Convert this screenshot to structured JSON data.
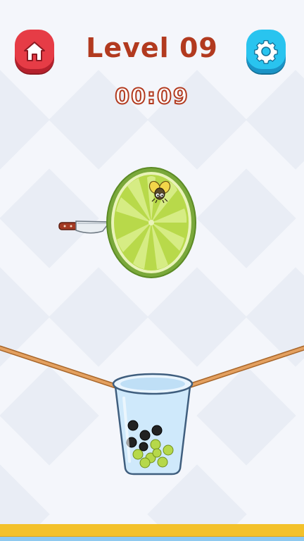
{
  "header": {
    "level_title": "Level 09",
    "timer": "00:09"
  },
  "buttons": {
    "home_icon": "home-icon",
    "settings_icon": "gear-icon"
  },
  "objects": {
    "lime_slice": "lime-slice",
    "knife": "knife",
    "fly": "fly",
    "cup": "cup",
    "black_balls": 5,
    "green_balls": 7
  },
  "colors": {
    "home_button": "#e63c46",
    "settings_button": "#29c4ef",
    "title": "#b23a1f",
    "lime": "#b8d94a",
    "rope": "#e3a060"
  }
}
